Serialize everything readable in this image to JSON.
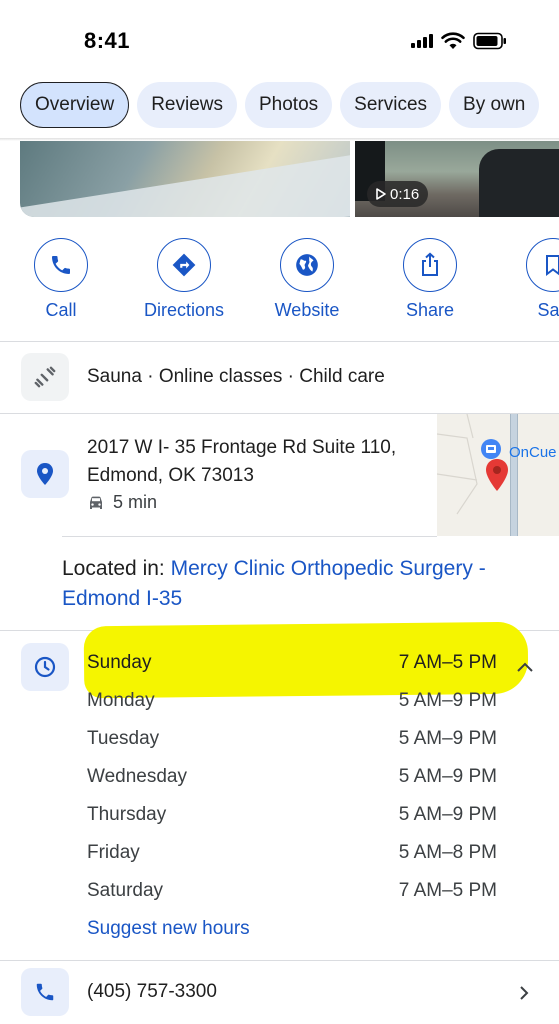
{
  "status_bar": {
    "time": "8:41"
  },
  "tabs": [
    {
      "label": "Overview",
      "active": true
    },
    {
      "label": "Reviews",
      "active": false
    },
    {
      "label": "Photos",
      "active": false
    },
    {
      "label": "Services",
      "active": false
    },
    {
      "label": "By own",
      "active": false
    }
  ],
  "media": {
    "video_duration": "0:16"
  },
  "actions": [
    {
      "label": "Call",
      "icon": "phone-icon"
    },
    {
      "label": "Directions",
      "icon": "directions-icon"
    },
    {
      "label": "Website",
      "icon": "globe-icon"
    },
    {
      "label": "Share",
      "icon": "share-icon"
    },
    {
      "label": "Sav",
      "icon": "bookmark-icon"
    }
  ],
  "amenities": "Sauna · Online classes · Child care",
  "address": {
    "line1": "2017 W I- 35 Frontage Rd Suite 110,",
    "line2": "Edmond, OK 73013",
    "drive_time": "5 min",
    "map_label": "OnCue"
  },
  "located_in": {
    "prefix": "Located in:",
    "place": "Mercy Clinic Orthopedic Surgery - Edmond I-35"
  },
  "hours": [
    {
      "day": "Sunday",
      "time": "7 AM–5 PM",
      "today": true
    },
    {
      "day": "Monday",
      "time": "5 AM–9 PM",
      "today": false
    },
    {
      "day": "Tuesday",
      "time": "5 AM–9 PM",
      "today": false
    },
    {
      "day": "Wednesday",
      "time": "5 AM–9 PM",
      "today": false
    },
    {
      "day": "Thursday",
      "time": "5 AM–9 PM",
      "today": false
    },
    {
      "day": "Friday",
      "time": "5 AM–8 PM",
      "today": false
    },
    {
      "day": "Saturday",
      "time": "7 AM–5 PM",
      "today": false
    }
  ],
  "suggest_hours": "Suggest new hours",
  "phone": "(405) 757-3300",
  "colors": {
    "accent": "#1a56c5",
    "highlight": "#f5f500",
    "chip": "#e8eefb"
  }
}
